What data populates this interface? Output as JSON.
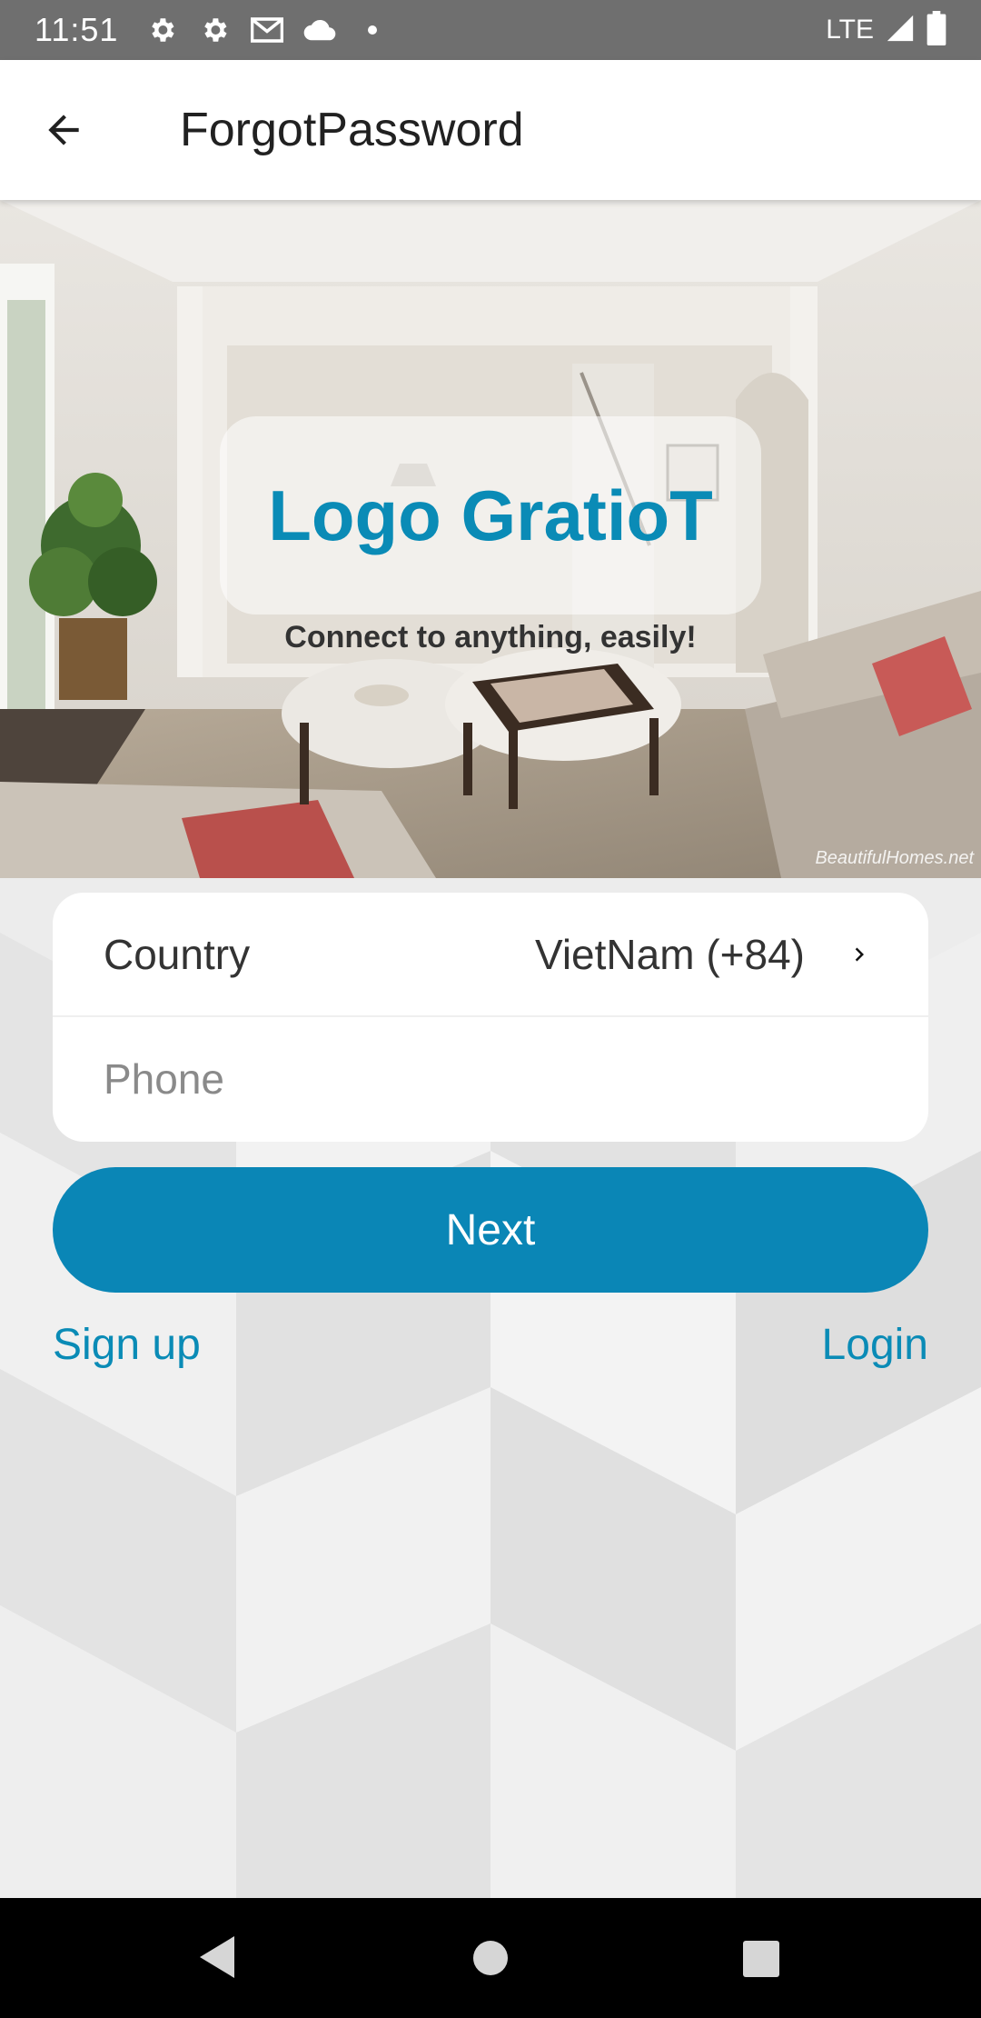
{
  "status_bar": {
    "time": "11:51",
    "network": "LTE",
    "icons": [
      "settings-icon",
      "settings-icon",
      "gmail-icon",
      "cloud-icon",
      "dot-icon",
      "signal-icon",
      "battery-icon"
    ]
  },
  "app_bar": {
    "title": "ForgotPassword",
    "back_icon": "arrow-back-icon"
  },
  "hero": {
    "logo_text": "Logo GratioT",
    "tagline": "Connect to anything, easily!",
    "watermark": "BeautifulHomes.net"
  },
  "form": {
    "country_label": "Country",
    "country_value": "VietNam (+84)",
    "phone_placeholder": "Phone",
    "phone_value": ""
  },
  "actions": {
    "next_label": "Next",
    "signup_label": "Sign up",
    "login_label": "Login"
  },
  "colors": {
    "accent": "#0a86b6",
    "status_bar": "#6f6f6f",
    "background": "#ececec"
  },
  "nav_bar": {
    "icons": [
      "nav-back-icon",
      "nav-home-icon",
      "nav-recents-icon"
    ]
  }
}
